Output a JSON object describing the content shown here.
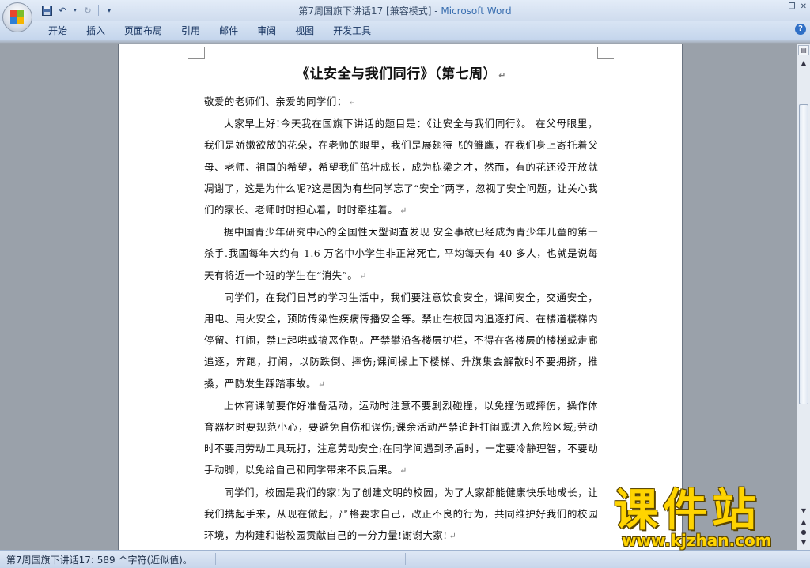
{
  "window": {
    "title": "第7周国旗下讲话17 [兼容模式] - ",
    "app_name": "Microsoft Word"
  },
  "quick_access": {
    "icons": [
      "save-icon",
      "undo-icon",
      "redo-icon",
      "customize-dropdown-icon"
    ]
  },
  "ribbon": {
    "tabs": [
      "开始",
      "插入",
      "页面布局",
      "引用",
      "邮件",
      "审阅",
      "视图",
      "开发工具"
    ]
  },
  "document": {
    "title": "《让安全与我们同行》（第七周）",
    "salutation": "敬爱的老师们、亲爱的同学们：",
    "paragraphs": [
      "大家早上好!今天我在国旗下讲话的题目是：《让安全与我们同行》。 在父母眼里，我们是娇嫩欲放的花朵，在老师的眼里，我们是展翅待飞的雏鹰，在我们身上寄托着父母、老师、祖国的希望，希望我们茁壮成长，成为栋梁之才，然而，有的花还没开放就凋谢了，这是为什么呢?这是因为有些同学忘了“安全”两字，忽视了安全问题，让关心我们的家长、老师时时担心着，时时牵挂着。",
      "据中国青少年研究中心的全国性大型调查发现 安全事故已经成为青少年儿童的第一杀手.我国每年大约有 1.6 万名中小学生非正常死亡, 平均每天有 40 多人，也就是说每天有将近一个班的学生在“消失”。",
      "同学们，在我们日常的学习生活中，我们要注意饮食安全，课间安全，交通安全，用电、用火安全，预防传染性疾病传播安全等。禁止在校园内追逐打闹、在楼道楼梯内停留、打闹，禁止起哄或搞恶作剧。严禁攀沿各楼层护栏，不得在各楼层的楼梯或走廊追逐，奔跑，打闹，以防跌倒、摔伤;课间操上下楼梯、升旗集会解散时不要拥挤，推搡，严防发生踩踏事故。",
      "上体育课前要作好准备活动，运动时注意不要剧烈碰撞，以免撞伤或摔伤，操作体育器材时要规范小心，要避免自伤和误伤;课余活动严禁追赶打闹或进入危险区域;劳动时不要用劳动工具玩打，注意劳动安全;在同学间遇到矛盾时，一定要冷静理智，不要动手动脚，以免给自己和同学带来不良后果。",
      "同学们，校园是我们的家!为了创建文明的校园，为了大家都能健康快乐地成长，让我们携起手来，从现在做起，严格要求自己，改正不良的行为，共同维护好我们的校园环境，为构建和谐校园贡献自己的一分力量!谢谢大家!"
    ],
    "paragraph_mark": "↵"
  },
  "status_bar": {
    "text": "第7周国旗下讲话17: 589 个字符(近似值)。"
  },
  "watermark": {
    "logo_text": "课件站",
    "url": "www.kjzhan.com"
  },
  "colors": {
    "ribbon": "#c4d5ec",
    "workspace": "#9aa1aa",
    "watermark_yellow": "#ffd400"
  }
}
